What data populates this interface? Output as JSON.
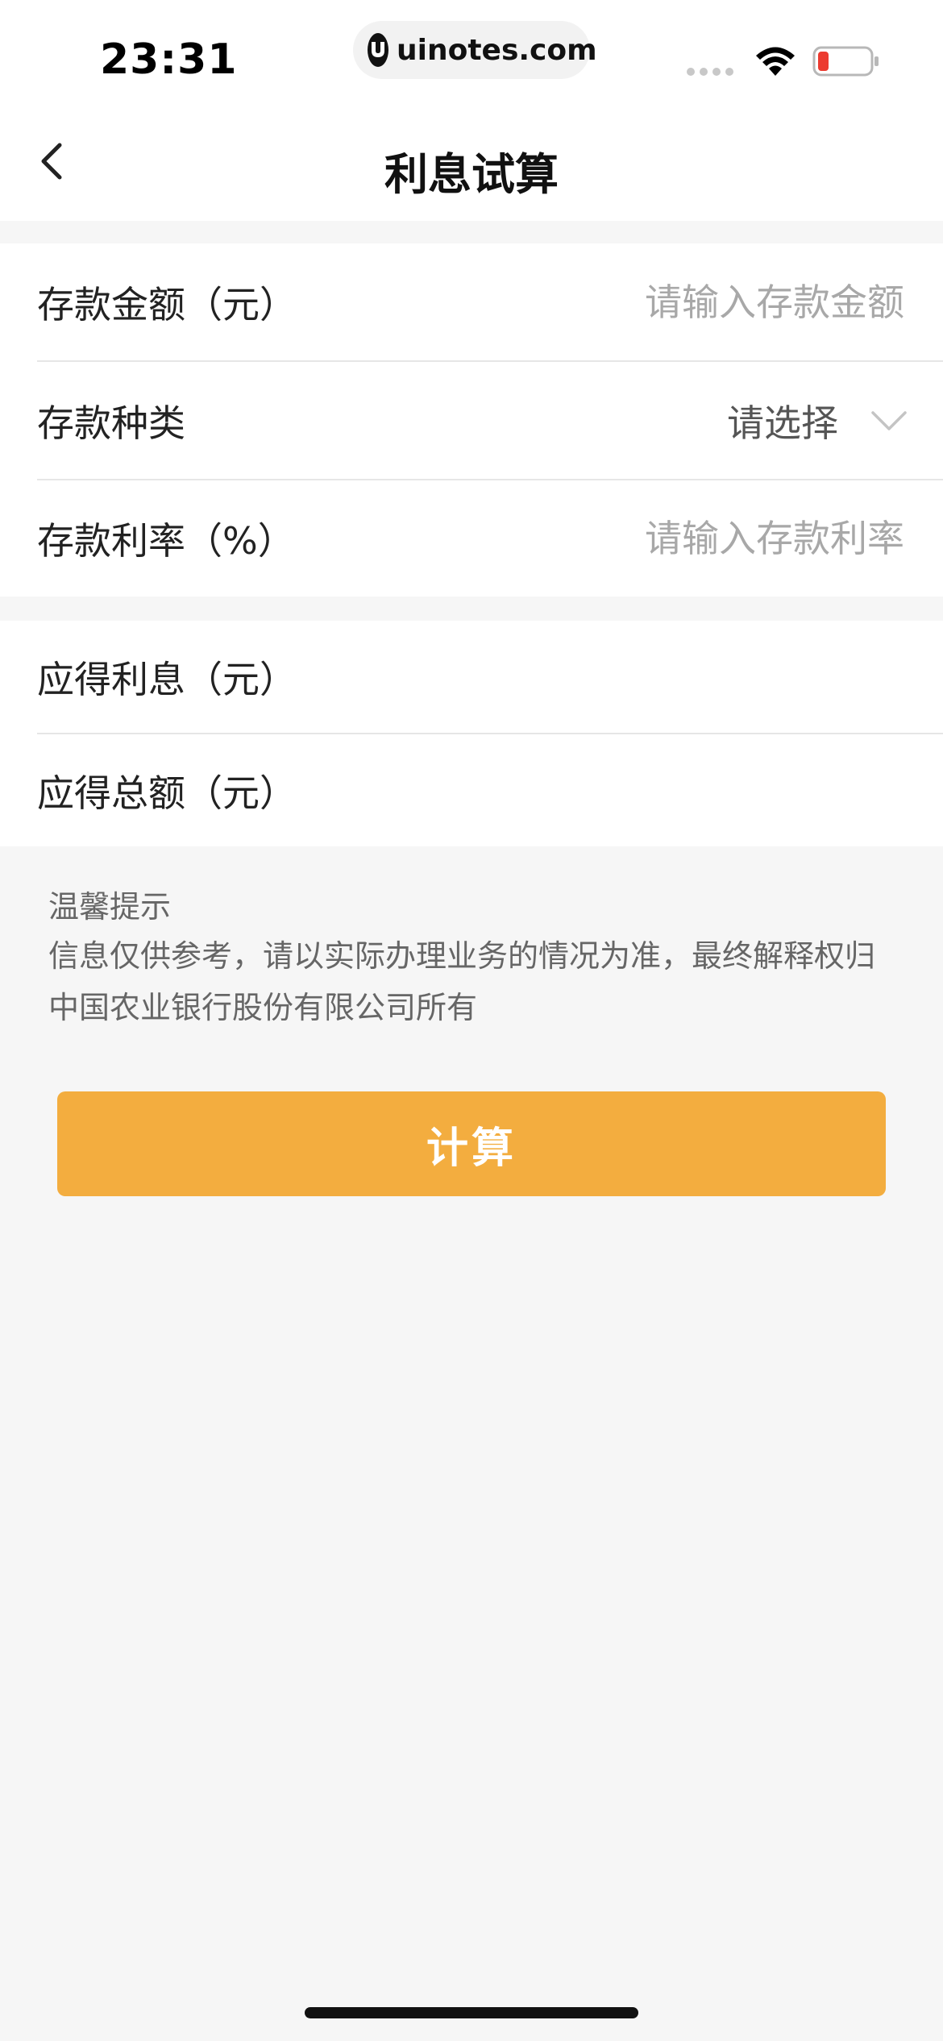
{
  "status_bar": {
    "time": "23:31",
    "url": "uinotes.com",
    "battery_color": "#ec3b30"
  },
  "nav": {
    "title": "利息试算"
  },
  "form": {
    "amount": {
      "label": "存款金额（元）",
      "placeholder": "请输入存款金额",
      "value": ""
    },
    "type": {
      "label": "存款种类",
      "value": "请选择"
    },
    "rate": {
      "label": "存款利率（%）",
      "placeholder": "请输入存款利率",
      "value": ""
    }
  },
  "results": {
    "interest": {
      "label": "应得利息（元）",
      "value": ""
    },
    "total": {
      "label": "应得总额（元）",
      "value": ""
    }
  },
  "tips": {
    "title": "温馨提示",
    "body": "信息仅供参考，请以实际办理业务的情况为准，最终解释权归中国农业银行股份有限公司所有"
  },
  "actions": {
    "calculate_label": "计算",
    "accent_color": "#f3ad3f"
  }
}
